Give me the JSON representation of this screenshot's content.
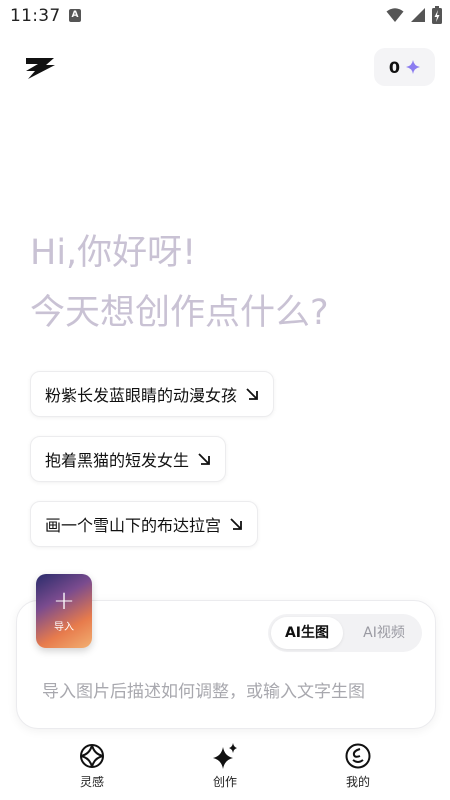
{
  "status_bar": {
    "time": "11:37",
    "notification_badge": "A"
  },
  "header": {
    "credits": "0",
    "credits_icon": "sparkle-icon",
    "logo_icon": "z-logo-icon"
  },
  "greeting": {
    "line1": "Hi,你好呀!",
    "line2": "今天想创作点什么?"
  },
  "suggestions": [
    {
      "label": "粉紫长发蓝眼睛的动漫女孩"
    },
    {
      "label": "抱着黑猫的短发女生"
    },
    {
      "label": "画一个雪山下的布达拉宫"
    }
  ],
  "composer": {
    "import_label": "导入",
    "modes": [
      {
        "label": "AI生图",
        "active": true
      },
      {
        "label": "AI视频",
        "active": false
      }
    ],
    "placeholder": "导入图片后描述如何调整，或输入文字生图"
  },
  "nav": [
    {
      "label": "灵感",
      "icon": "inspiration-icon"
    },
    {
      "label": "创作",
      "icon": "sparkle-create-icon"
    },
    {
      "label": "我的",
      "icon": "profile-face-icon"
    }
  ],
  "colors": {
    "greeting": "#c9c2d4",
    "accent": "#8b7cf0"
  }
}
